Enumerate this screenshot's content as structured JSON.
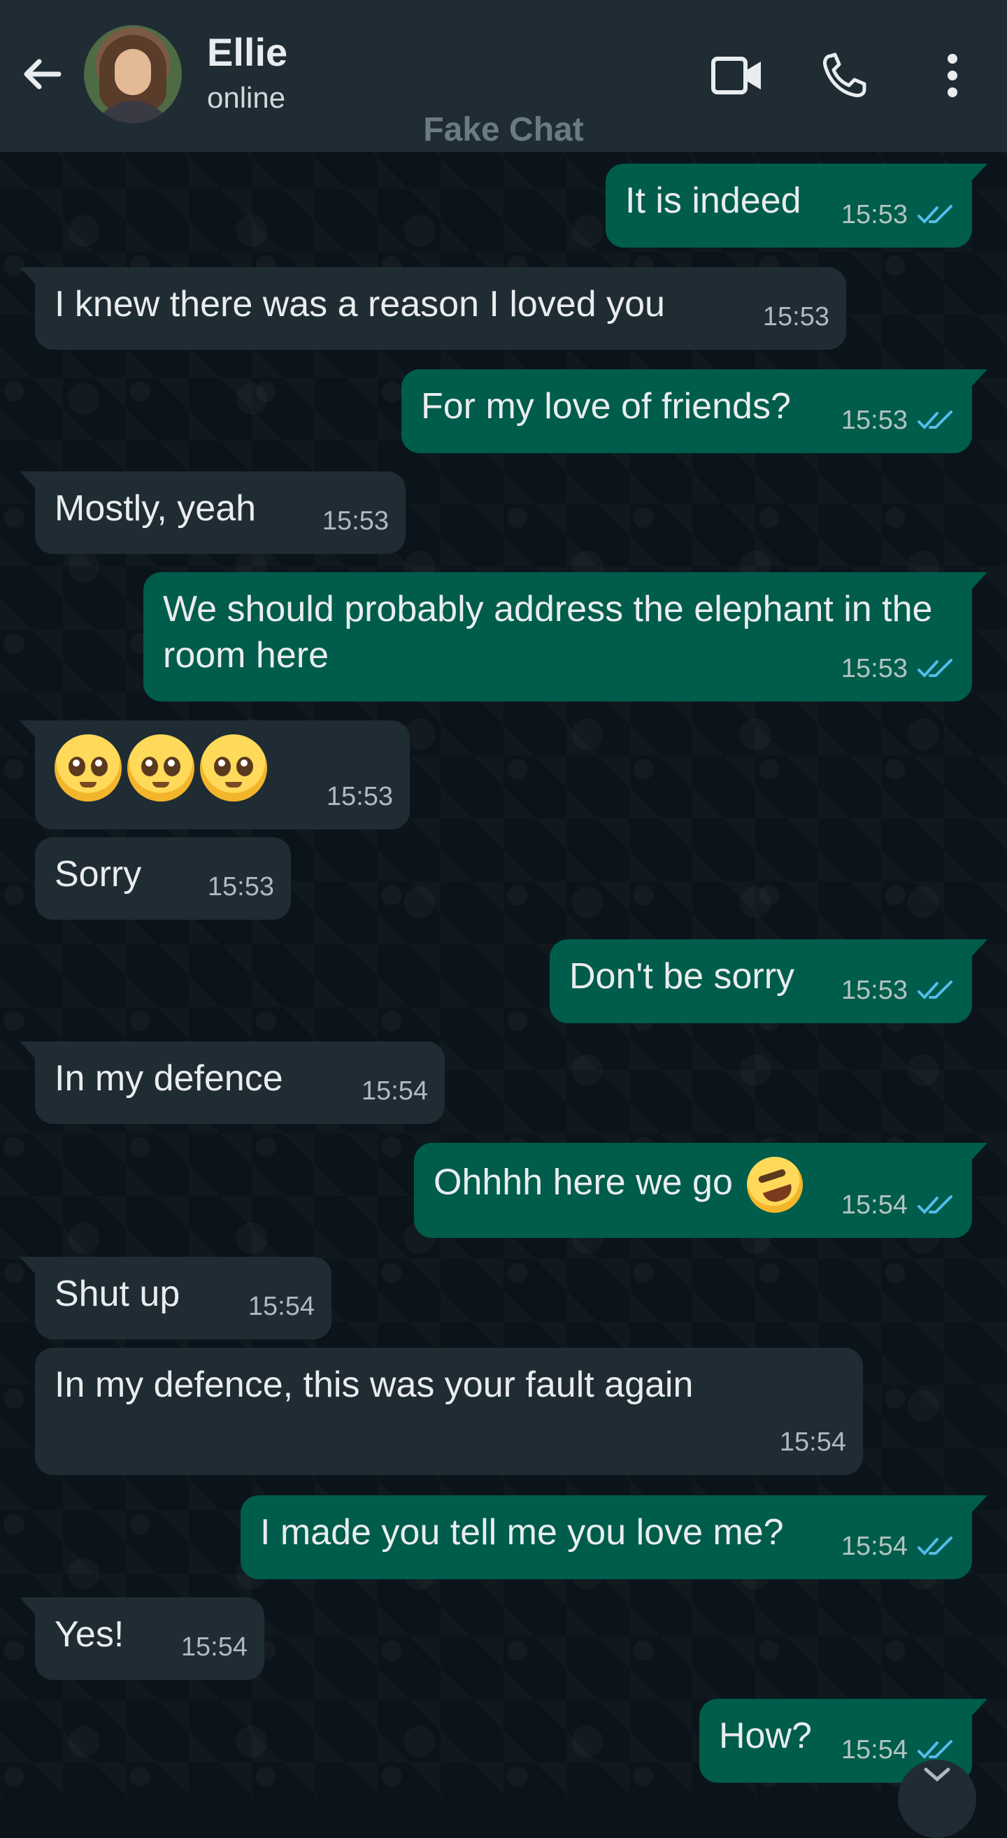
{
  "header": {
    "contact_name": "Ellie",
    "contact_status": "online",
    "watermark": "Fake Chat",
    "icons": [
      "back-arrow-icon",
      "video-call-icon",
      "voice-call-icon",
      "more-options-icon"
    ]
  },
  "colors": {
    "header_bg": "#1f2c34",
    "chat_bg": "#0b141a",
    "incoming_bubble": "#202c33",
    "outgoing_bubble": "#005c4b",
    "read_ticks": "#53bdeb"
  },
  "messages": [
    {
      "dir": "out",
      "text": "It is indeed",
      "time": "15:53",
      "read": true
    },
    {
      "dir": "in",
      "text": "I knew there was a reason I loved you",
      "time": "15:53"
    },
    {
      "dir": "out",
      "text": "For my love of friends?",
      "time": "15:53",
      "read": true
    },
    {
      "dir": "in",
      "text": "Mostly, yeah",
      "time": "15:53"
    },
    {
      "dir": "out",
      "text": "We should probably address the elephant in the room here",
      "time": "15:53",
      "read": true
    },
    {
      "dir": "in",
      "text": "🥹🥹🥹",
      "time": "15:53"
    },
    {
      "dir": "in",
      "text": "Sorry",
      "time": "15:53"
    },
    {
      "dir": "out",
      "text": "Don't be sorry",
      "time": "15:53",
      "read": true
    },
    {
      "dir": "in",
      "text": "In my defence",
      "time": "15:54"
    },
    {
      "dir": "out",
      "text": "Ohhhh here we go 🤣",
      "time": "15:54",
      "read": true
    },
    {
      "dir": "in",
      "text": "Shut up",
      "time": "15:54"
    },
    {
      "dir": "in",
      "text": "In my defence, this was your fault again",
      "time": "15:54"
    },
    {
      "dir": "out",
      "text": "I made you tell me you love me?",
      "time": "15:54",
      "read": true
    },
    {
      "dir": "in",
      "text": "Yes!",
      "time": "15:54"
    },
    {
      "dir": "out",
      "text": "How?",
      "time": "15:54",
      "read": true
    }
  ]
}
